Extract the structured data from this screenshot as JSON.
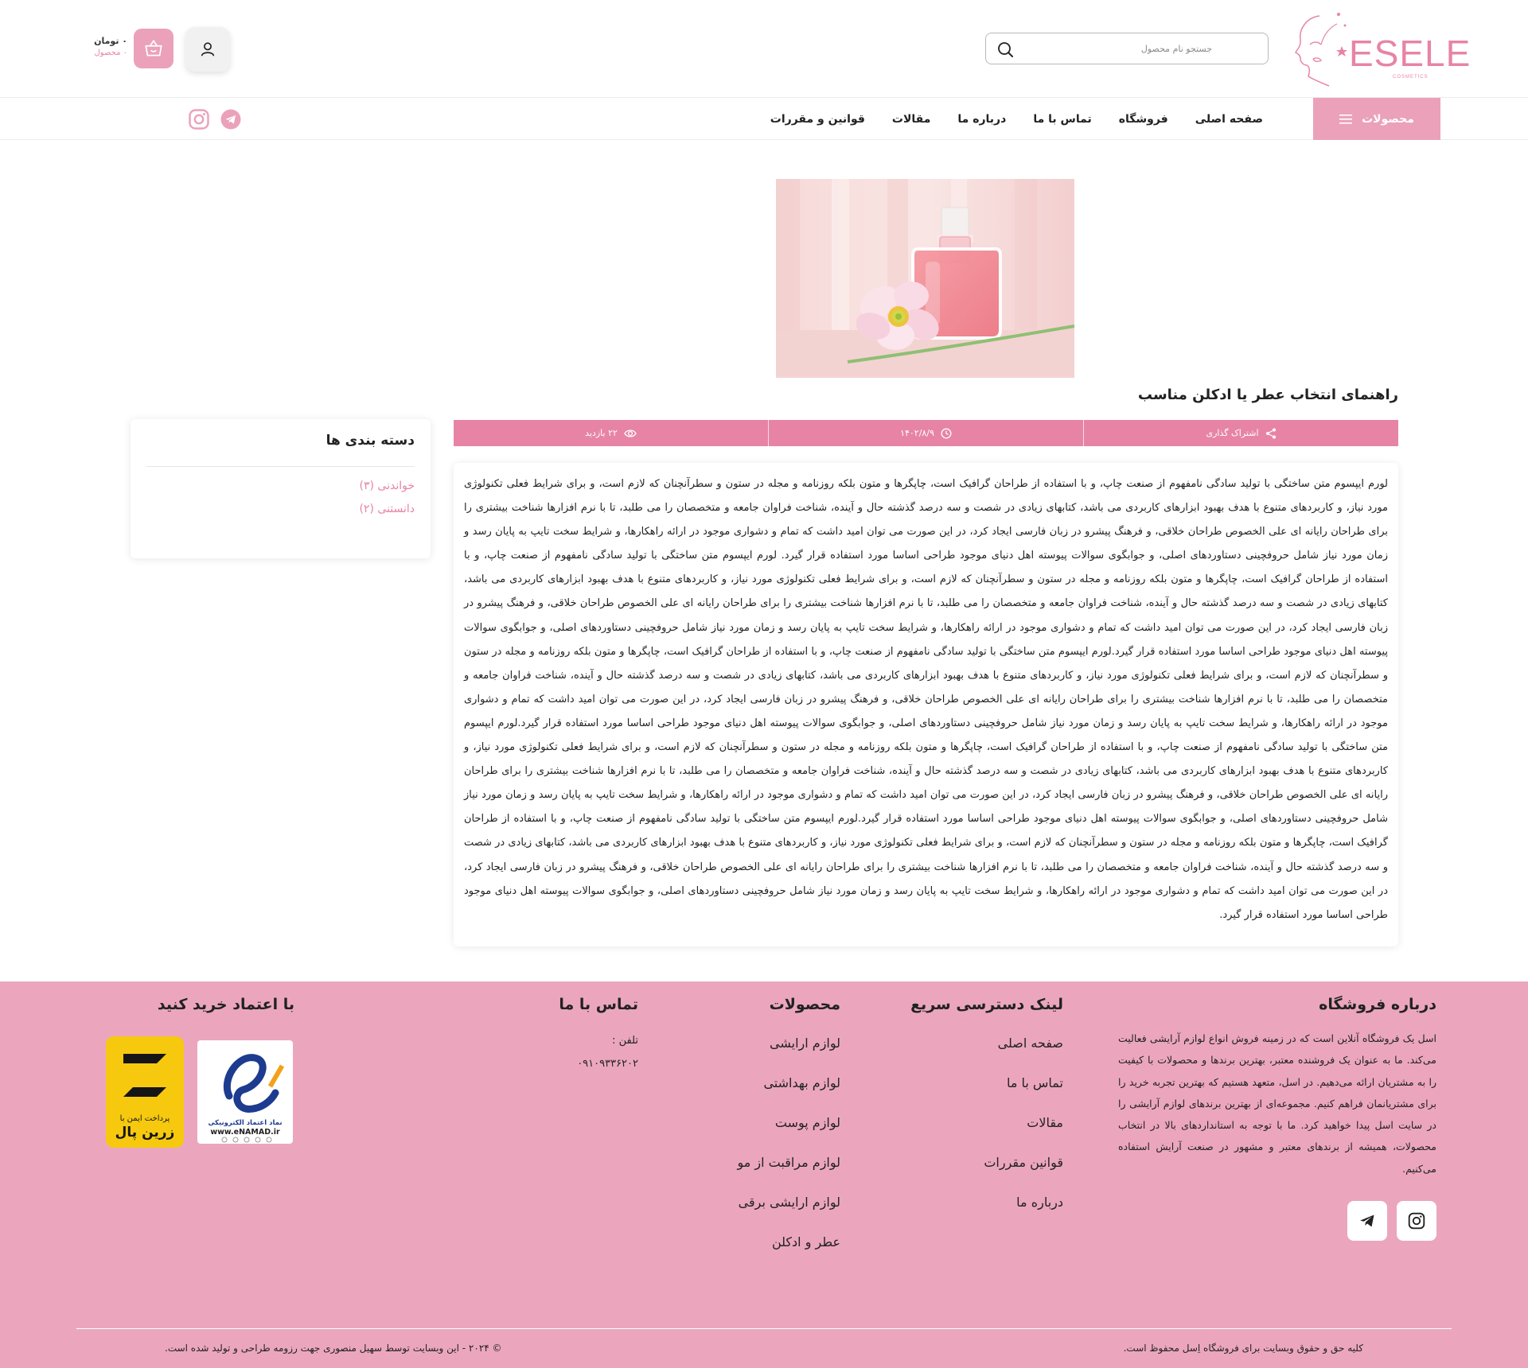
{
  "brand": {
    "name": "ESELE",
    "tagline": "COSMETICS",
    "accent": "#e784a6",
    "accent_light": "#eba6be"
  },
  "header": {
    "search_placeholder": "جستجو نام محصول",
    "cart_total": "۰ تومان",
    "cart_count": "۰ محصول"
  },
  "nav": {
    "categories_label": "محصولات",
    "items": [
      "صفحه اصلی",
      "فروشگاه",
      "تماس با ما",
      "درباره ما",
      "مقالات",
      "قوانین و مقررات"
    ]
  },
  "article": {
    "title": "راهنمای انتخاب عطر یا ادکلن مناسب",
    "share_label": "اشتراک گذاری",
    "date": "۱۴۰۲/۸/۹",
    "views": "۲۲ بازدید",
    "body": "لورم ایپسوم متن ساختگی با تولید سادگی نامفهوم از صنعت چاپ، و با استفاده از طراحان گرافیک است، چاپگرها و متون بلکه روزنامه و مجله در ستون و سطرآنچنان که لازم است، و برای شرایط فعلی تکنولوژی مورد نیاز، و کاربردهای متنوع با هدف بهبود ابزارهای کاربردی می باشد، کتابهای زیادی در شصت و سه درصد گذشته حال و آینده، شناخت فراوان جامعه و متخصصان را می طلبد، تا با نرم افزارها شناخت بیشتری را برای طراحان رایانه ای علی الخصوص طراحان خلاقی، و فرهنگ پیشرو در زبان فارسی ایجاد کرد، در این صورت می توان امید داشت که تمام و دشواری موجود در ارائه راهکارها، و شرایط سخت تایپ به پایان رسد و زمان مورد نیاز شامل حروفچینی دستاوردهای اصلی، و جوابگوی سوالات پیوسته اهل دنیای موجود طراحی اساسا مورد استفاده قرار گیرد. لورم ایپسوم متن ساختگی با تولید سادگی نامفهوم از صنعت چاپ، و با استفاده از طراحان گرافیک است، چاپگرها و متون بلکه روزنامه و مجله در ستون و سطرآنچنان که لازم است، و برای شرایط فعلی تکنولوژی مورد نیاز، و کاربردهای متنوع با هدف بهبود ابزارهای کاربردی می باشد، کتابهای زیادی در شصت و سه درصد گذشته حال و آینده، شناخت فراوان جامعه و متخصصان را می طلبد، تا با نرم افزارها شناخت بیشتری را برای طراحان رایانه ای علی الخصوص طراحان خلاقی، و فرهنگ پیشرو در زبان فارسی ایجاد کرد، در این صورت می توان امید داشت که تمام و دشواری موجود در ارائه راهکارها، و شرایط سخت تایپ به پایان رسد و زمان مورد نیاز شامل حروفچینی دستاوردهای اصلی، و جوابگوی سوالات پیوسته اهل دنیای موجود طراحی اساسا مورد استفاده قرار گیرد.لورم ایپسوم متن ساختگی با تولید سادگی نامفهوم از صنعت چاپ، و با استفاده از طراحان گرافیک است، چاپگرها و متون بلکه روزنامه و مجله در ستون و سطرآنچنان که لازم است، و برای شرایط فعلی تکنولوژی مورد نیاز، و کاربردهای متنوع با هدف بهبود ابزارهای کاربردی می باشد، کتابهای زیادی در شصت و سه درصد گذشته حال و آینده، شناخت فراوان جامعه و متخصصان را می طلبد، تا با نرم افزارها شناخت بیشتری را برای طراحان رایانه ای علی الخصوص طراحان خلاقی، و فرهنگ پیشرو در زبان فارسی ایجاد کرد، در این صورت می توان امید داشت که تمام و دشواری موجود در ارائه راهکارها، و شرایط سخت تایپ به پایان رسد و زمان مورد نیاز شامل حروفچینی دستاوردهای اصلی، و جوابگوی سوالات پیوسته اهل دنیای موجود طراحی اساسا مورد استفاده قرار گیرد.لورم ایپسوم متن ساختگی با تولید سادگی نامفهوم از صنعت چاپ، و با استفاده از طراحان گرافیک است، چاپگرها و متون بلکه روزنامه و مجله در ستون و سطرآنچنان که لازم است، و برای شرایط فعلی تکنولوژی مورد نیاز، و کاربردهای متنوع با هدف بهبود ابزارهای کاربردی می باشد، کتابهای زیادی در شصت و سه درصد گذشته حال و آینده، شناخت فراوان جامعه و متخصصان را می طلبد، تا با نرم افزارها شناخت بیشتری را برای طراحان رایانه ای علی الخصوص طراحان خلاقی، و فرهنگ پیشرو در زبان فارسی ایجاد کرد، در این صورت می توان امید داشت که تمام و دشواری موجود در ارائه راهکارها، و شرایط سخت تایپ به پایان رسد و زمان مورد نیاز شامل حروفچینی دستاوردهای اصلی، و جوابگوی سوالات پیوسته اهل دنیای موجود طراحی اساسا مورد استفاده قرار گیرد.لورم ایپسوم متن ساختگی با تولید سادگی نامفهوم از صنعت چاپ، و با استفاده از طراحان گرافیک است، چاپگرها و متون بلکه روزنامه و مجله در ستون و سطرآنچنان که لازم است، و برای شرایط فعلی تکنولوژی مورد نیاز، و کاربردهای متنوع با هدف بهبود ابزارهای کاربردی می باشد، کتابهای زیادی در شصت و سه درصد گذشته حال و آینده، شناخت فراوان جامعه و متخصصان را می طلبد، تا با نرم افزارها شناخت بیشتری را برای طراحان رایانه ای علی الخصوص طراحان خلاقی، و فرهنگ پیشرو در زبان فارسی ایجاد کرد، در این صورت می توان امید داشت که تمام و دشواری موجود در ارائه راهکارها، و شرایط سخت تایپ به پایان رسد و زمان مورد نیاز شامل حروفچینی دستاوردهای اصلی، و جوابگوی سوالات پیوسته اهل دنیای موجود طراحی اساسا مورد استفاده قرار گیرد."
  },
  "sidebar": {
    "title": "دسته بندی ها",
    "items": [
      "خواندنی (۳)",
      "دانستنی (۲)"
    ]
  },
  "footer": {
    "about_title": "درباره فروشگاه",
    "about_text": "اسل یک فروشگاه آنلاین است که در زمینه فروش انواع لوازم آرایشی فعالیت می‌کند. ما به عنوان یک فروشنده معتبر، بهترین برندها و محصولات با کیفیت را به مشتریان ارائه می‌دهیم. در اسل، متعهد هستیم که بهترین تجربه خرید را برای مشتریانمان فراهم کنیم. مجموعه‌ای از بهترین برندهای لوازم آرایشی را در سایت اسل پیدا خواهید کرد. ما با توجه به استانداردهای بالا در انتخاب محصولات، همیشه از برندهای معتبر و مشهور در صنعت آرایش استفاده می‌کنیم.",
    "links_title": "لینک دسترسی سریع",
    "links": [
      "صفحه اصلی",
      "تماس با ما",
      "مقالات",
      "قوانین مقررات",
      "درباره ما"
    ],
    "products_title": "محصولات",
    "products": [
      "لوازم ارایشی",
      "لوازم بهداشتی",
      "لوازم پوست",
      "لوازم مراقبت از مو",
      "لوازم ارایشی برقی",
      "عطر و ادکلن"
    ],
    "contact_title": "تماس با ما",
    "phone_label": "تلفن :",
    "phone": "۰۹۱۰۹۳۳۶۲۰۲",
    "trust_title": "با اعتماد خرید کنید",
    "enamad_caption": "نماد اعتماد الکترونیکی",
    "enamad_url": "www.eNAMAD.ir",
    "zarinpal_caption": "پرداخت ایمن با",
    "zarinpal_name": "زرین پال",
    "copyright_right": "کلیه حق و حقوق وبسایت برای فروشگاه اِسل محفوظ است.",
    "copyright_left": "© ۲۰۲۴ - این وبسایت توسط سهیل منصوری جهت رزومه طراحی و تولید شده است."
  }
}
